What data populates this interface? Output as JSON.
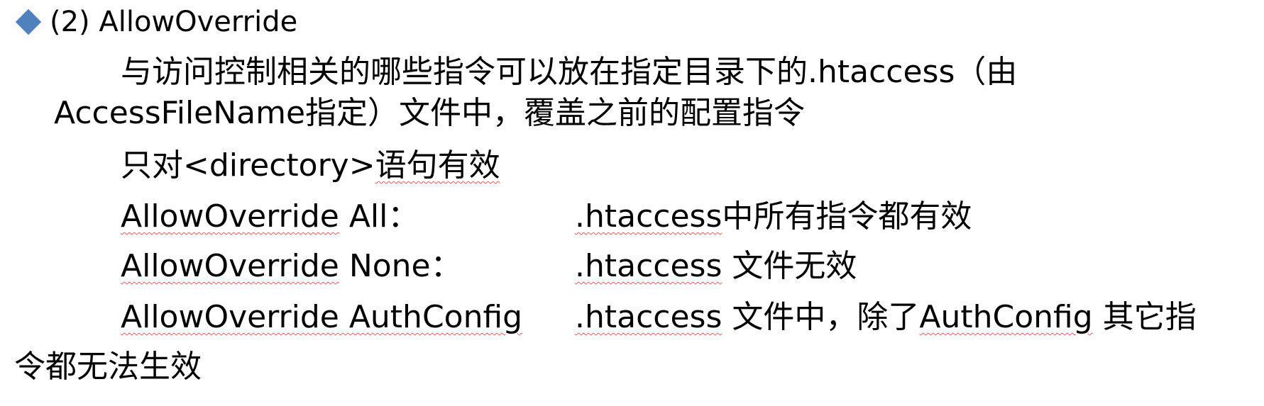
{
  "slide": {
    "heading": "(2) AllowOverride",
    "line1": "与访问控制相关的哪些指令可以放在指定目录下的.htaccess（由",
    "line2": "AccessFileName指定）文件中，覆盖之前的配置指令",
    "line3_prefix": "只对<directory>",
    "line3_suffix": "语句有效",
    "rows": [
      {
        "directive_keyword": "AllowOverride",
        "directive_value": " All：",
        "file": ".htaccess",
        "desc": "中所有指令都有效"
      },
      {
        "directive_keyword": "AllowOverride",
        "directive_value": " None：",
        "file": ".htaccess",
        "desc": " 文件无效"
      },
      {
        "directive_keyword": "AllowOverride",
        "directive_value": " AuthConfig",
        "file": ".htaccess",
        "desc_a": " 文件中，除了",
        "desc_b": "AuthConfig",
        "desc_c": " 其它指"
      }
    ],
    "last_line": "令都无法生效"
  },
  "colors": {
    "bullet": "#4f81bd",
    "spellcheck_underline": "#e06060",
    "text": "#000000"
  }
}
